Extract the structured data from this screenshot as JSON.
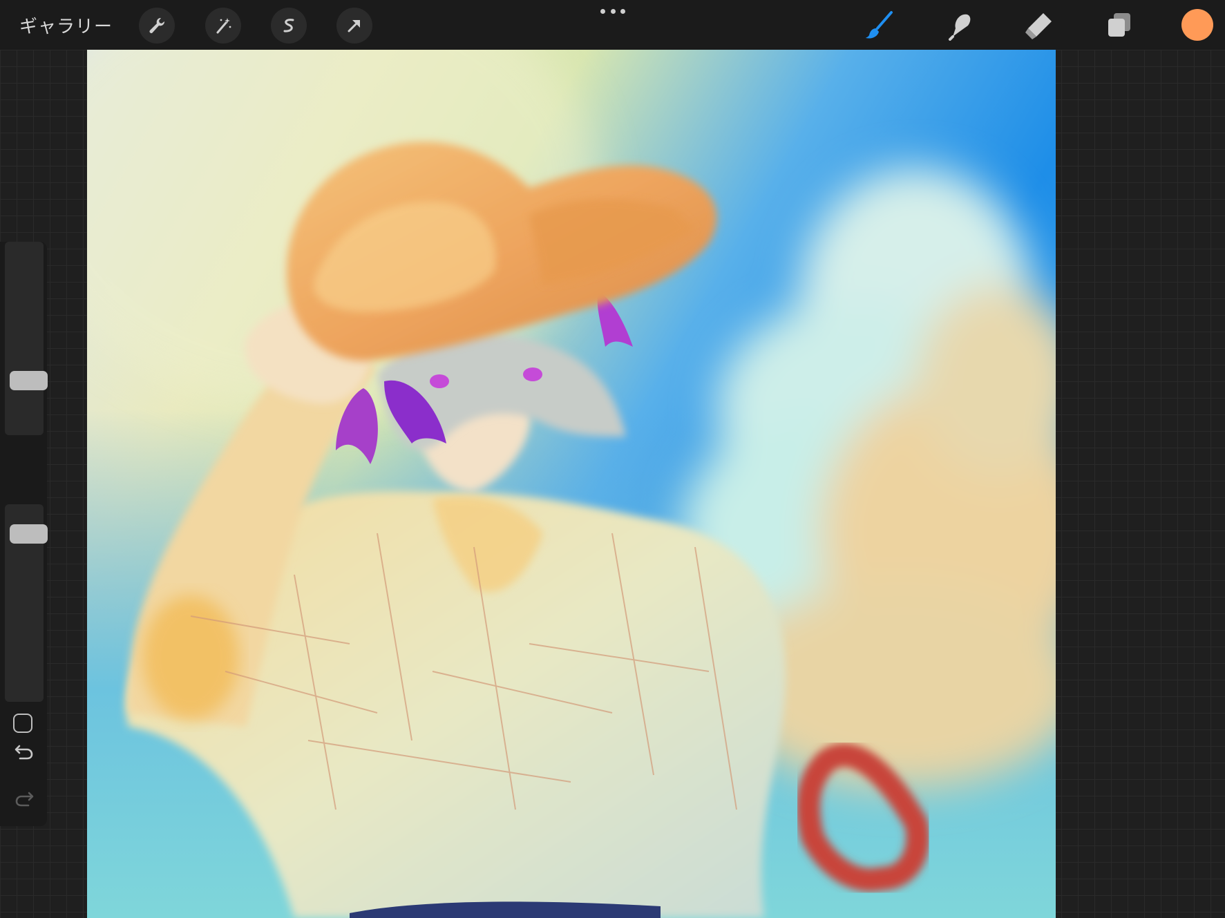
{
  "topbar": {
    "gallery_label": "ギャラリー",
    "left_tools": [
      {
        "name": "actions",
        "icon": "wrench-icon"
      },
      {
        "name": "adjustments",
        "icon": "magic-wand-icon"
      },
      {
        "name": "selection",
        "icon": "selection-s-icon"
      },
      {
        "name": "transform",
        "icon": "arrow-cursor-icon"
      }
    ],
    "more_menu_icon": "more-dots-icon",
    "right_tools": [
      {
        "name": "brush",
        "icon": "brush-icon",
        "active": true
      },
      {
        "name": "smudge",
        "icon": "smudge-finger-icon",
        "active": false
      },
      {
        "name": "eraser",
        "icon": "eraser-icon",
        "active": false
      },
      {
        "name": "layers",
        "icon": "layers-icon",
        "active": false
      }
    ],
    "current_color": "#ff9a57",
    "accent_color": "#1f8ff1"
  },
  "sidebar": {
    "brush_size_level": 0.25,
    "opacity_level": 0.9,
    "modify_button_icon": "square-icon",
    "undo_icon": "undo-icon",
    "redo_icon": "redo-icon"
  },
  "canvas": {
    "content": "digital-painting"
  }
}
